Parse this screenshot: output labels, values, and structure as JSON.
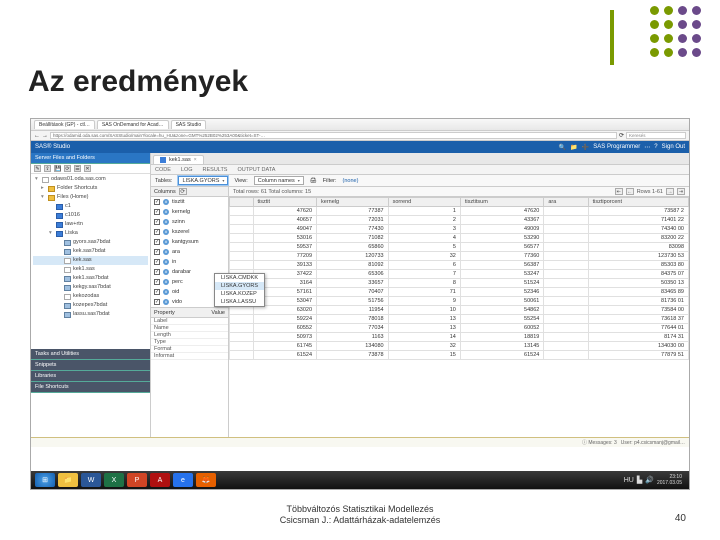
{
  "slide": {
    "title": "Az eredmények",
    "page": "40",
    "caption1": "Többváltozós Statisztikai Modellezés",
    "caption2": "Csicsman J.: Adattárházak-adatelemzés"
  },
  "browser": {
    "tab1": "Beállítások (GP) - ctl…",
    "tab2": "SAS OnDemand for Acad…",
    "tab3": "SAS Studio",
    "url": "https://odamid.oda.sas.com/SASStudio/main?locale=hu_HU&zone=GMT%252B02%253A00&ticket=ST-…",
    "search_ph": "Keresés"
  },
  "sas": {
    "brand": "SAS® Studio",
    "signout": "Sign Out",
    "prog_label": "SAS Programmer"
  },
  "sidebar": {
    "section_server": "Server Files and Folders",
    "section_tasks": "Tasks and Utilities",
    "section_libraries": "Libraries",
    "section_snippets": "Snippets",
    "section_shortcuts": "File Shortcuts",
    "tree": [
      {
        "lvl": 0,
        "tri": "▾",
        "ico": "wht",
        "label": "odaws01.oda.sas.com"
      },
      {
        "lvl": 1,
        "tri": "▸",
        "ico": "",
        "label": "Folder Shortcuts"
      },
      {
        "lvl": 1,
        "tri": "▾",
        "ico": "",
        "label": "Files (Home)"
      },
      {
        "lvl": 2,
        "tri": "",
        "ico": "blu",
        "label": "c1"
      },
      {
        "lvl": 2,
        "tri": "",
        "ico": "blu",
        "label": "c1016"
      },
      {
        "lvl": 2,
        "tri": "",
        "ico": "blu",
        "label": "law+rtn"
      },
      {
        "lvl": 2,
        "tri": "▾",
        "ico": "blu",
        "label": "Liska"
      },
      {
        "lvl": 3,
        "tri": "",
        "ico": "ss",
        "label": "gyors.sas7bdat"
      },
      {
        "lvl": 3,
        "tri": "",
        "ico": "ss",
        "label": "kek.sas7bdat"
      },
      {
        "lvl": 3,
        "tri": "",
        "ico": "wht",
        "label": "kek.sas",
        "sel": true
      },
      {
        "lvl": 3,
        "tri": "",
        "ico": "wht",
        "label": "kek1.sas"
      },
      {
        "lvl": 3,
        "tri": "",
        "ico": "ss",
        "label": "kek1.sas7bdat"
      },
      {
        "lvl": 3,
        "tri": "",
        "ico": "ss",
        "label": "kekgy.sas7bdat"
      },
      {
        "lvl": 3,
        "tri": "",
        "ico": "wht",
        "label": "kekozodas"
      },
      {
        "lvl": 3,
        "tri": "",
        "ico": "ss",
        "label": "kozepes7bdat"
      },
      {
        "lvl": 3,
        "tri": "",
        "ico": "ss",
        "label": "lassu.sas7bdat"
      }
    ]
  },
  "content": {
    "file_tab": "kek1.sas",
    "mode_tabs": [
      "CODE",
      "LOG",
      "RESULTS",
      "OUTPUT DATA"
    ],
    "table_label": "Tables:",
    "table_value": "LISKA.GYORS",
    "table_options": [
      "LISKA.CMDKK",
      "LISKA.GYORS",
      "LISKA.KOZEP",
      "LISKA.LASSU"
    ],
    "view_label": "View:",
    "view_value": "Column names",
    "filter_label": "Filter:",
    "filter_value": "(none)",
    "totals": "Total rows: 61  Total columns: 15",
    "rows_label": "Rows 1-61",
    "columns_label": "Columns",
    "columns": [
      {
        "t": "n",
        "name": "tisztit"
      },
      {
        "t": "n",
        "name": "kernelg"
      },
      {
        "t": "n",
        "name": "szinn"
      },
      {
        "t": "n",
        "name": "kszerel"
      },
      {
        "t": "n",
        "name": "kantgysum"
      },
      {
        "t": "n",
        "name": "ara"
      },
      {
        "t": "n",
        "name": "in"
      },
      {
        "t": "n",
        "name": "darabar"
      },
      {
        "t": "n",
        "name": "perc"
      },
      {
        "t": "n",
        "name": "oid"
      },
      {
        "t": "n",
        "name": "vido"
      }
    ],
    "properties": {
      "title": "Property",
      "vtitle": "Value",
      "rows": [
        [
          "Label",
          ""
        ],
        [
          "Name",
          ""
        ],
        [
          "Length",
          ""
        ],
        [
          "Type",
          ""
        ],
        [
          "Format",
          ""
        ],
        [
          "Informat",
          ""
        ]
      ]
    }
  },
  "grid": {
    "headers": [
      "",
      "tisztit",
      "kernelg",
      "sorrend",
      "tisztitsum",
      "ara",
      "tisztiporcent"
    ],
    "rows": [
      [
        "",
        "47620",
        "77387",
        "1",
        "47620",
        "",
        "73587 2"
      ],
      [
        "",
        "40657",
        "72031",
        "2",
        "43367",
        "",
        "71401 22"
      ],
      [
        "",
        "49047",
        "77430",
        "3",
        "49009",
        "",
        "74340 00"
      ],
      [
        "",
        "53016",
        "71082",
        "4",
        "53290",
        "",
        "83200 22"
      ],
      [
        "",
        "59537",
        "65860",
        "5",
        "56577",
        "",
        "83098"
      ],
      [
        "",
        "77209",
        "120733",
        "32",
        "77360",
        "",
        "123730 53"
      ],
      [
        "",
        "39133",
        "81092",
        "6",
        "56387",
        "",
        "85303 80"
      ],
      [
        "",
        "37422",
        "65306",
        "7",
        "53247",
        "",
        "84375 07"
      ],
      [
        "",
        "3164",
        "33657",
        "8",
        "51524",
        "",
        "50350 13"
      ],
      [
        "",
        "57161",
        "70407",
        "71",
        "52346",
        "",
        "83465 89"
      ],
      [
        "",
        "53047",
        "51756",
        "9",
        "50061",
        "",
        "81736 01"
      ],
      [
        "",
        "63020",
        "11954",
        "10",
        "54862",
        "",
        "73584 00"
      ],
      [
        "",
        "59224",
        "78018",
        "13",
        "55254",
        "",
        "73618 37"
      ],
      [
        "",
        "60552",
        "77034",
        "13",
        "60052",
        "",
        "77644 01"
      ],
      [
        "",
        "50973",
        "1163",
        "14",
        "18819",
        "",
        "8174 31"
      ],
      [
        "",
        "61745",
        "134080",
        "32",
        "13145",
        "",
        "134030 00"
      ],
      [
        "",
        "61524",
        "73878",
        "15",
        "61524",
        "",
        "77879 51"
      ]
    ]
  },
  "status": {
    "msg": "Messages: 3",
    "user": "User: p4.csicsmanj@gmail…"
  },
  "taskbar": {
    "hu": "HU",
    "time": "23:10",
    "date": "2017.03.05"
  }
}
